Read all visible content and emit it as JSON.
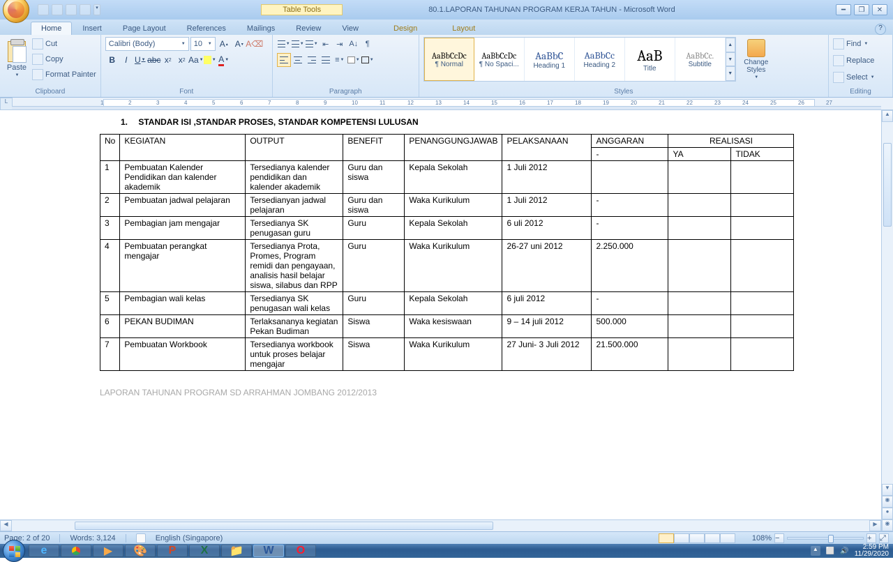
{
  "titlebar": {
    "context_tab": "Table Tools",
    "doc_title": "80.1.LAPORAN TAHUNAN PROGRAM KERJA TAHUN - Microsoft Word"
  },
  "tabs": {
    "home": "Home",
    "insert": "Insert",
    "page_layout": "Page Layout",
    "references": "References",
    "mailings": "Mailings",
    "review": "Review",
    "view": "View",
    "design": "Design",
    "layout": "Layout"
  },
  "ribbon": {
    "clipboard": {
      "paste": "Paste",
      "cut": "Cut",
      "copy": "Copy",
      "painter": "Format Painter",
      "label": "Clipboard"
    },
    "font": {
      "name": "Calibri (Body)",
      "size": "10",
      "label": "Font"
    },
    "paragraph": {
      "label": "Paragraph"
    },
    "styles": {
      "label": "Styles",
      "change": "Change Styles",
      "items": [
        {
          "sample": "AaBbCcDc",
          "name": "¶ Normal"
        },
        {
          "sample": "AaBbCcDc",
          "name": "¶ No Spaci..."
        },
        {
          "sample": "AaBbC",
          "name": "Heading 1"
        },
        {
          "sample": "AaBbCc",
          "name": "Heading 2"
        },
        {
          "sample": "AaB",
          "name": "Title"
        },
        {
          "sample": "AaBbCc.",
          "name": "Subtitle"
        }
      ]
    },
    "editing": {
      "find": "Find",
      "replace": "Replace",
      "select": "Select",
      "label": "Editing"
    }
  },
  "document": {
    "heading_num": "1.",
    "heading_text": "STANDAR ISI ,STANDAR PROSES, STANDAR KOMPETENSI LULUSAN",
    "headers": {
      "no": "No",
      "kegiatan": "KEGIATAN",
      "output": "OUTPUT",
      "benefit": "BENEFIT",
      "pj": "PENANGGUNGJAWAB",
      "pelaksanaan": "PELAKSANAAN",
      "anggaran": "ANGGARAN",
      "realisasi": "REALISASI",
      "ya": "YA",
      "tidak": "TIDAK",
      "dash": "-"
    },
    "rows": [
      {
        "no": "1",
        "kegiatan": "Pembuatan Kalender Pendidikan dan kalender akademik",
        "output": "Tersedianya kalender pendidikan dan kalender akademik",
        "benefit": "Guru dan siswa",
        "pj": "Kepala Sekolah",
        "pelaksanaan": "1 Juli 2012",
        "anggaran": ""
      },
      {
        "no": "2",
        "kegiatan": "Pembuatan jadwal pelajaran",
        "output": "Tersedianyan jadwal pelajaran",
        "benefit": "Guru dan siswa",
        "pj": "Waka Kurikulum",
        "pelaksanaan": "1 Juli 2012",
        "anggaran": "-"
      },
      {
        "no": "3",
        "kegiatan": "Pembagian jam mengajar",
        "output": "Tersedianya SK penugasan guru",
        "benefit": "Guru",
        "pj": "Kepala Sekolah",
        "pelaksanaan": "6 uli 2012",
        "anggaran": "-"
      },
      {
        "no": "4",
        "kegiatan": "Pembuatan perangkat mengajar",
        "output": "Tersedianya Prota, Promes, Program remidi dan pengayaan, analisis hasil belajar siswa, silabus dan RPP",
        "benefit": "Guru",
        "pj": "Waka Kurikulum",
        "pelaksanaan": "26-27 uni 2012",
        "anggaran": "2.250.000"
      },
      {
        "no": "5",
        "kegiatan": "Pembagian wali kelas",
        "output": "Tersedianya SK penugasan wali kelas",
        "benefit": "Guru",
        "pj": "Kepala Sekolah",
        "pelaksanaan": "6 juli 2012",
        "anggaran": "-"
      },
      {
        "no": "6",
        "kegiatan": "PEKAN BUDIMAN",
        "output": "Terlaksananya kegiatan Pekan Budiman",
        "benefit": "Siswa",
        "pj": "Waka kesiswaan",
        "pelaksanaan": "9 – 14 juli 2012",
        "anggaran": "500.000"
      },
      {
        "no": "7",
        "kegiatan": "Pembuatan Workbook",
        "output": "Tersedianya workbook untuk proses belajar mengajar",
        "benefit": "Siswa",
        "pj": "Waka Kurikulum",
        "pelaksanaan": "27 Juni- 3 Juli 2012",
        "anggaran": "21.500.000"
      }
    ],
    "footer": "LAPORAN TAHUNAN PROGRAM SD ARRAHMAN JOMBANG 2012/2013"
  },
  "status": {
    "page": "Page: 2 of 20",
    "words": "Words: 3,124",
    "language": "English (Singapore)",
    "zoom": "108%"
  },
  "tray": {
    "time": "2:59 PM",
    "date": "11/29/2020"
  },
  "col_widths": {
    "no": 28,
    "kegiatan": 180,
    "output": 140,
    "benefit": 88,
    "pj": 128,
    "pelaksanaan": 128,
    "anggaran": 110,
    "ya": 90,
    "tidak": 90
  }
}
